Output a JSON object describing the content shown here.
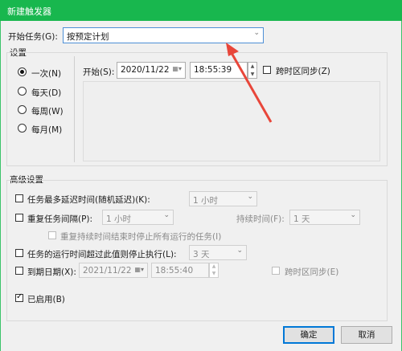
{
  "window": {
    "title": "新建触发器"
  },
  "start_task": {
    "label": "开始任务(G):",
    "value": "按预定计划"
  },
  "settings": {
    "heading": "设置",
    "options": [
      "一次(N)",
      "每天(D)",
      "每周(W)",
      "每月(M)"
    ],
    "start_label": "开始(S):",
    "start_date": "2020/11/22",
    "start_time": "18:55:39",
    "sync_label": "跨时区同步(Z)"
  },
  "advanced": {
    "heading": "高级设置",
    "delay_label": "任务最多延迟时间(随机延迟)(K):",
    "delay_value": "1 小时",
    "repeat_label": "重复任务间隔(P):",
    "repeat_value": "1 小时",
    "duration_label": "持续时间(F):",
    "duration_value": "1 天",
    "stop_running_label": "重复持续时间结束时停止所有运行的任务(I)",
    "stop_longer_label": "任务的运行时间超过此值则停止执行(L):",
    "stop_longer_value": "3 天",
    "expire_label": "到期日期(X):",
    "expire_date": "2021/11/22",
    "expire_time": "18:55:40",
    "expire_sync_label": "跨时区同步(E)",
    "enabled_label": "已启用(B)"
  },
  "buttons": {
    "ok": "确定",
    "cancel": "取消"
  },
  "colors": {
    "titlebar": "#18b74e",
    "arrow": "#e8463a"
  }
}
